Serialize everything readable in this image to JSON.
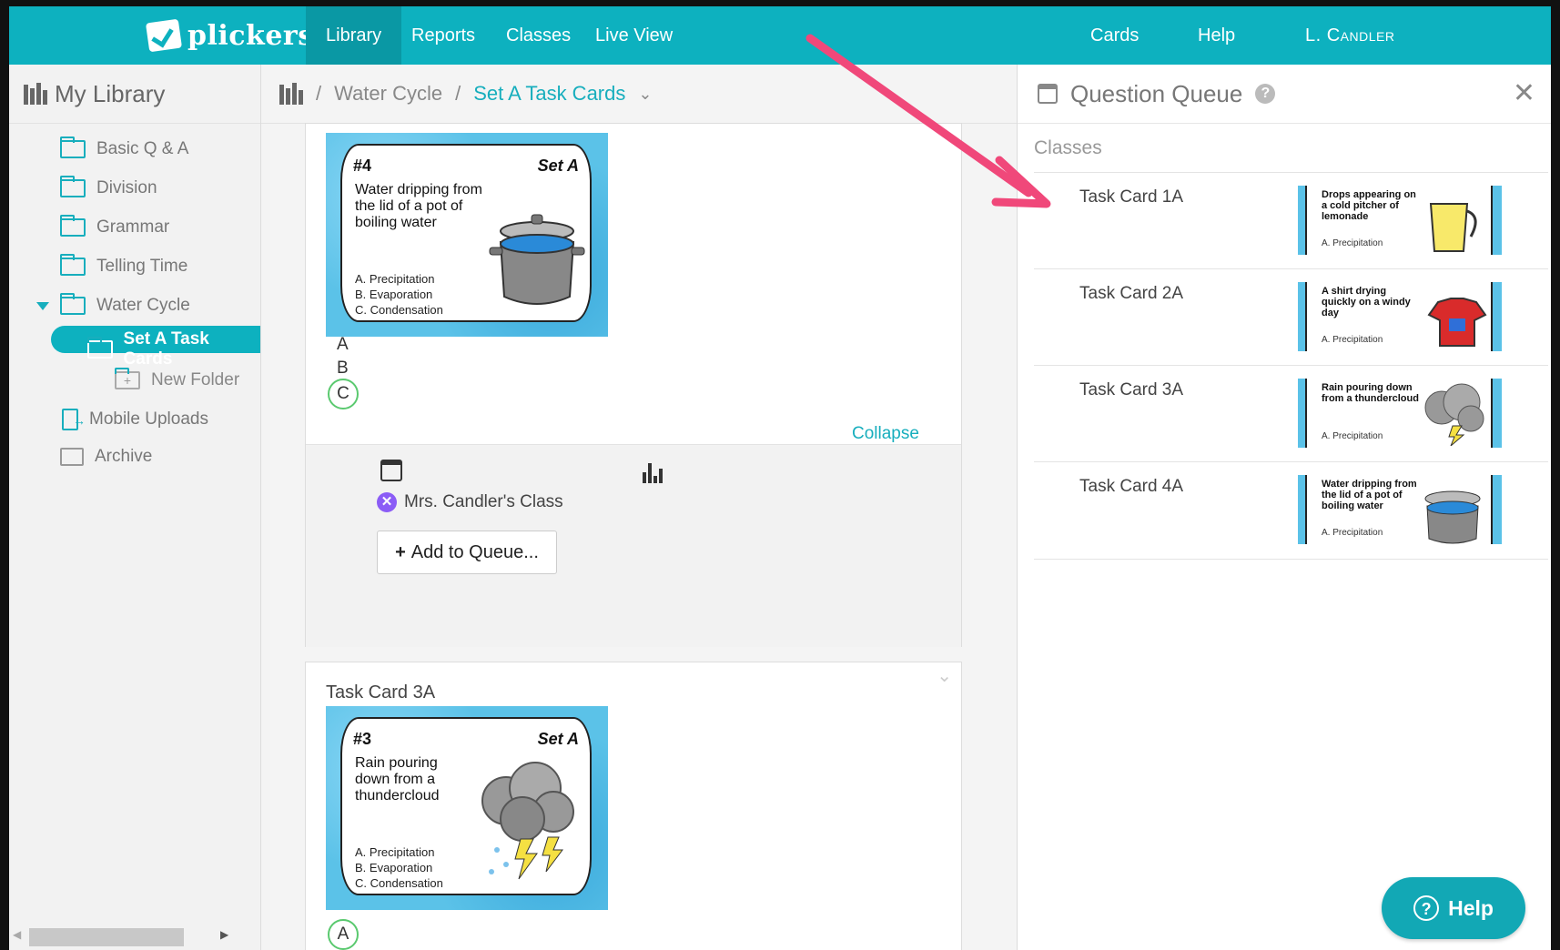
{
  "nav": {
    "logo_text": "plickers",
    "items": [
      {
        "label": "Library",
        "active": true
      },
      {
        "label": "Reports"
      },
      {
        "label": "Classes"
      },
      {
        "label": "Live View"
      }
    ],
    "right_items": [
      {
        "label": "Cards"
      },
      {
        "label": "Help"
      },
      {
        "label": "L. Candler"
      }
    ]
  },
  "sidebar": {
    "title": "My Library",
    "items": [
      {
        "label": "Basic Q & A"
      },
      {
        "label": "Division"
      },
      {
        "label": "Grammar"
      },
      {
        "label": "Telling Time"
      },
      {
        "label": "Water Cycle"
      },
      {
        "label": "Set A Task Cards"
      },
      {
        "label": "New Folder"
      },
      {
        "label": "Mobile Uploads"
      },
      {
        "label": "Archive"
      }
    ]
  },
  "breadcrumb": {
    "sep": "/",
    "folder": "Water Cycle",
    "current": "Set A Task Cards"
  },
  "card1": {
    "num": "#4",
    "set": "Set A",
    "question": "Water dripping from the lid of a pot of boiling water",
    "options": [
      "A. Precipitation",
      "B. Evaporation",
      "C. Condensation"
    ],
    "answers": [
      "A",
      "B",
      "C"
    ],
    "collapse": "Collapse",
    "class_name": "Mrs. Candler's Class",
    "add_queue": "Add to Queue..."
  },
  "card2": {
    "title": "Task Card 3A",
    "num": "#3",
    "set": "Set A",
    "question": "Rain pouring down from a thundercloud",
    "options": [
      "A. Precipitation",
      "B. Evaporation",
      "C. Condensation"
    ],
    "answers": [
      "A"
    ]
  },
  "queue": {
    "title": "Question Queue",
    "classes_label": "Classes",
    "items": [
      {
        "label": "Task Card 1A",
        "thumb_q": "Drops appearing on a cold pitcher of lemonade",
        "thumb_opt": "A. Precipitation"
      },
      {
        "label": "Task Card 2A",
        "thumb_q": "A shirt drying quickly on a windy day",
        "thumb_opt": "A. Precipitation"
      },
      {
        "label": "Task Card 3A",
        "thumb_q": "Rain pouring down from a thundercloud",
        "thumb_opt": "A. Precipitation"
      },
      {
        "label": "Task Card 4A",
        "thumb_q": "Water dripping from the lid of a pot of boiling water",
        "thumb_opt": "A. Precipitation"
      }
    ]
  },
  "help_button": "Help",
  "colors": {
    "brand": "#0db1bf",
    "arrow": "#f0487a"
  }
}
